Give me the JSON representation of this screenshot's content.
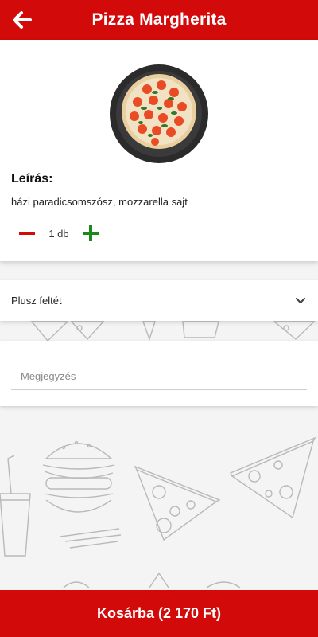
{
  "header": {
    "title": "Pizza Margherita",
    "back_icon": "arrow-left-icon"
  },
  "product": {
    "image": "pizza-margherita-photo",
    "description_heading": "Leírás:",
    "description": "házi paradicsomszósz, mozzarella  sajt",
    "quantity": "1 db",
    "decrement_icon": "minus-icon",
    "increment_icon": "plus-icon"
  },
  "extras": {
    "label": "Plusz feltét",
    "icon": "chevron-down-icon"
  },
  "note": {
    "placeholder": "Megjegyzés",
    "value": ""
  },
  "footer": {
    "button_label": "Kosárba (2 170 Ft)"
  },
  "colors": {
    "primary": "#d30a0a",
    "minus": "#d30a0a",
    "plus": "#1b8a1b",
    "background": "#f4f4f4"
  }
}
